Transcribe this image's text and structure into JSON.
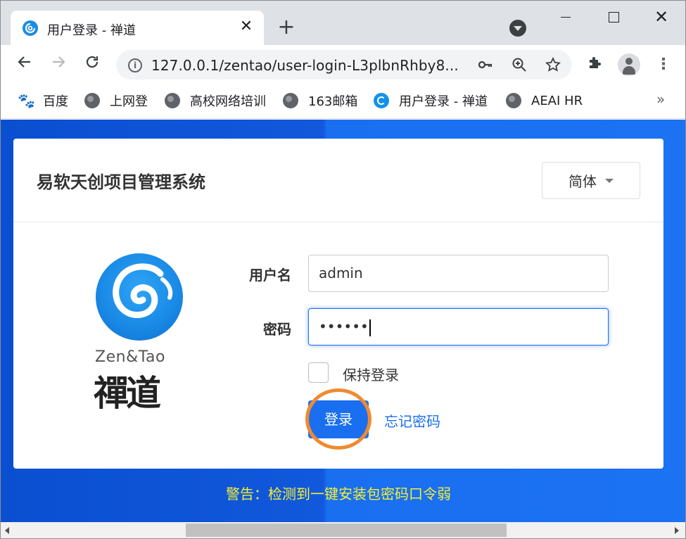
{
  "browser": {
    "tab_title": "用户登录 - 禅道",
    "tab_close": "✕",
    "new_tab": "+",
    "window_close": "✕",
    "url": "127.0.0.1/zentao/user-login-L3plbnRhby8...",
    "bookmarks": [
      {
        "label": "百度",
        "icon": "baidu-icon"
      },
      {
        "label": "上网登",
        "icon": "globe-icon"
      },
      {
        "label": "高校网络培训",
        "icon": "globe-icon"
      },
      {
        "label": "163邮箱",
        "icon": "globe-icon"
      },
      {
        "label": "用户登录 - 禅道",
        "icon": "zentao-icon"
      },
      {
        "label": "AEAI HR",
        "icon": "globe-icon"
      }
    ],
    "bookmarks_more": "»"
  },
  "page": {
    "system_title": "易软天创项目管理系统",
    "language": "简体",
    "logo_en": "Zen&Tao",
    "logo_cn": "禪道",
    "username_label": "用户名",
    "username_value": "admin",
    "password_label": "密码",
    "password_value": "••••••",
    "keep_login_label": "保持登录",
    "login_button": "登录",
    "forgot_password": "忘记密码",
    "warning": "警告：检测到一键安装包密码口令弱"
  },
  "colors": {
    "accent": "#1a6ff0",
    "background_left": "#0a4fd0",
    "background_right": "#1b72f2",
    "warning": "#f5f032",
    "highlight": "#f08a30"
  }
}
